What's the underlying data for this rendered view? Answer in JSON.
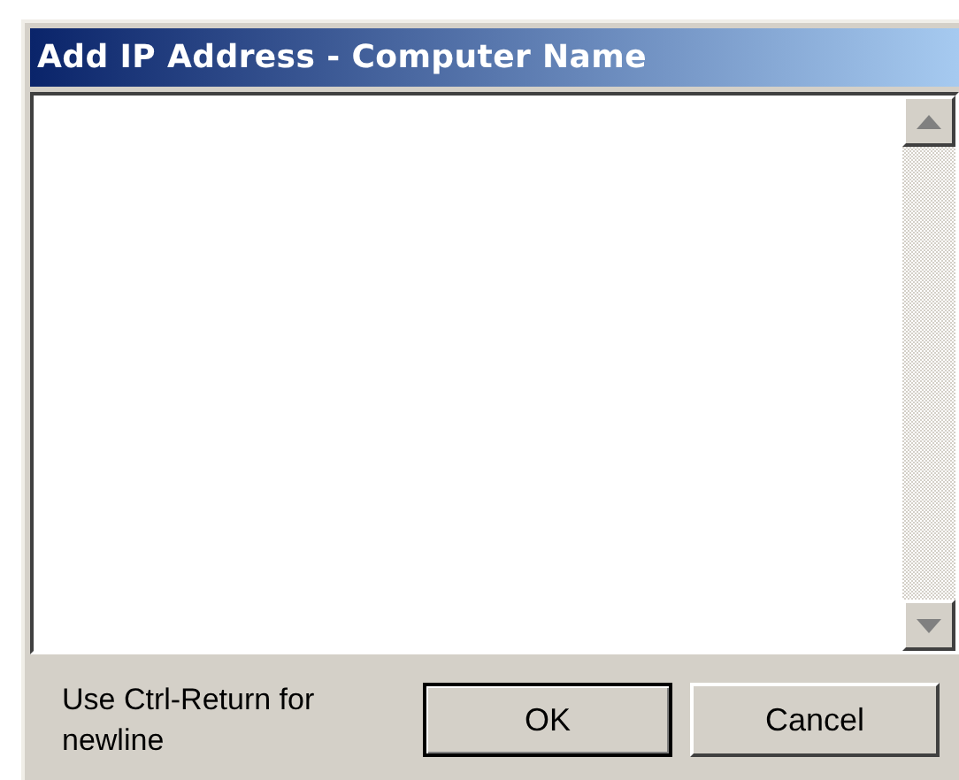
{
  "window": {
    "title": "Add IP Address - Computer Name"
  },
  "hint": "Use Ctrl-Return for newline",
  "buttons": [
    {
      "label": "OK",
      "default": true
    },
    {
      "label": "Cancel",
      "default": false
    }
  ]
}
